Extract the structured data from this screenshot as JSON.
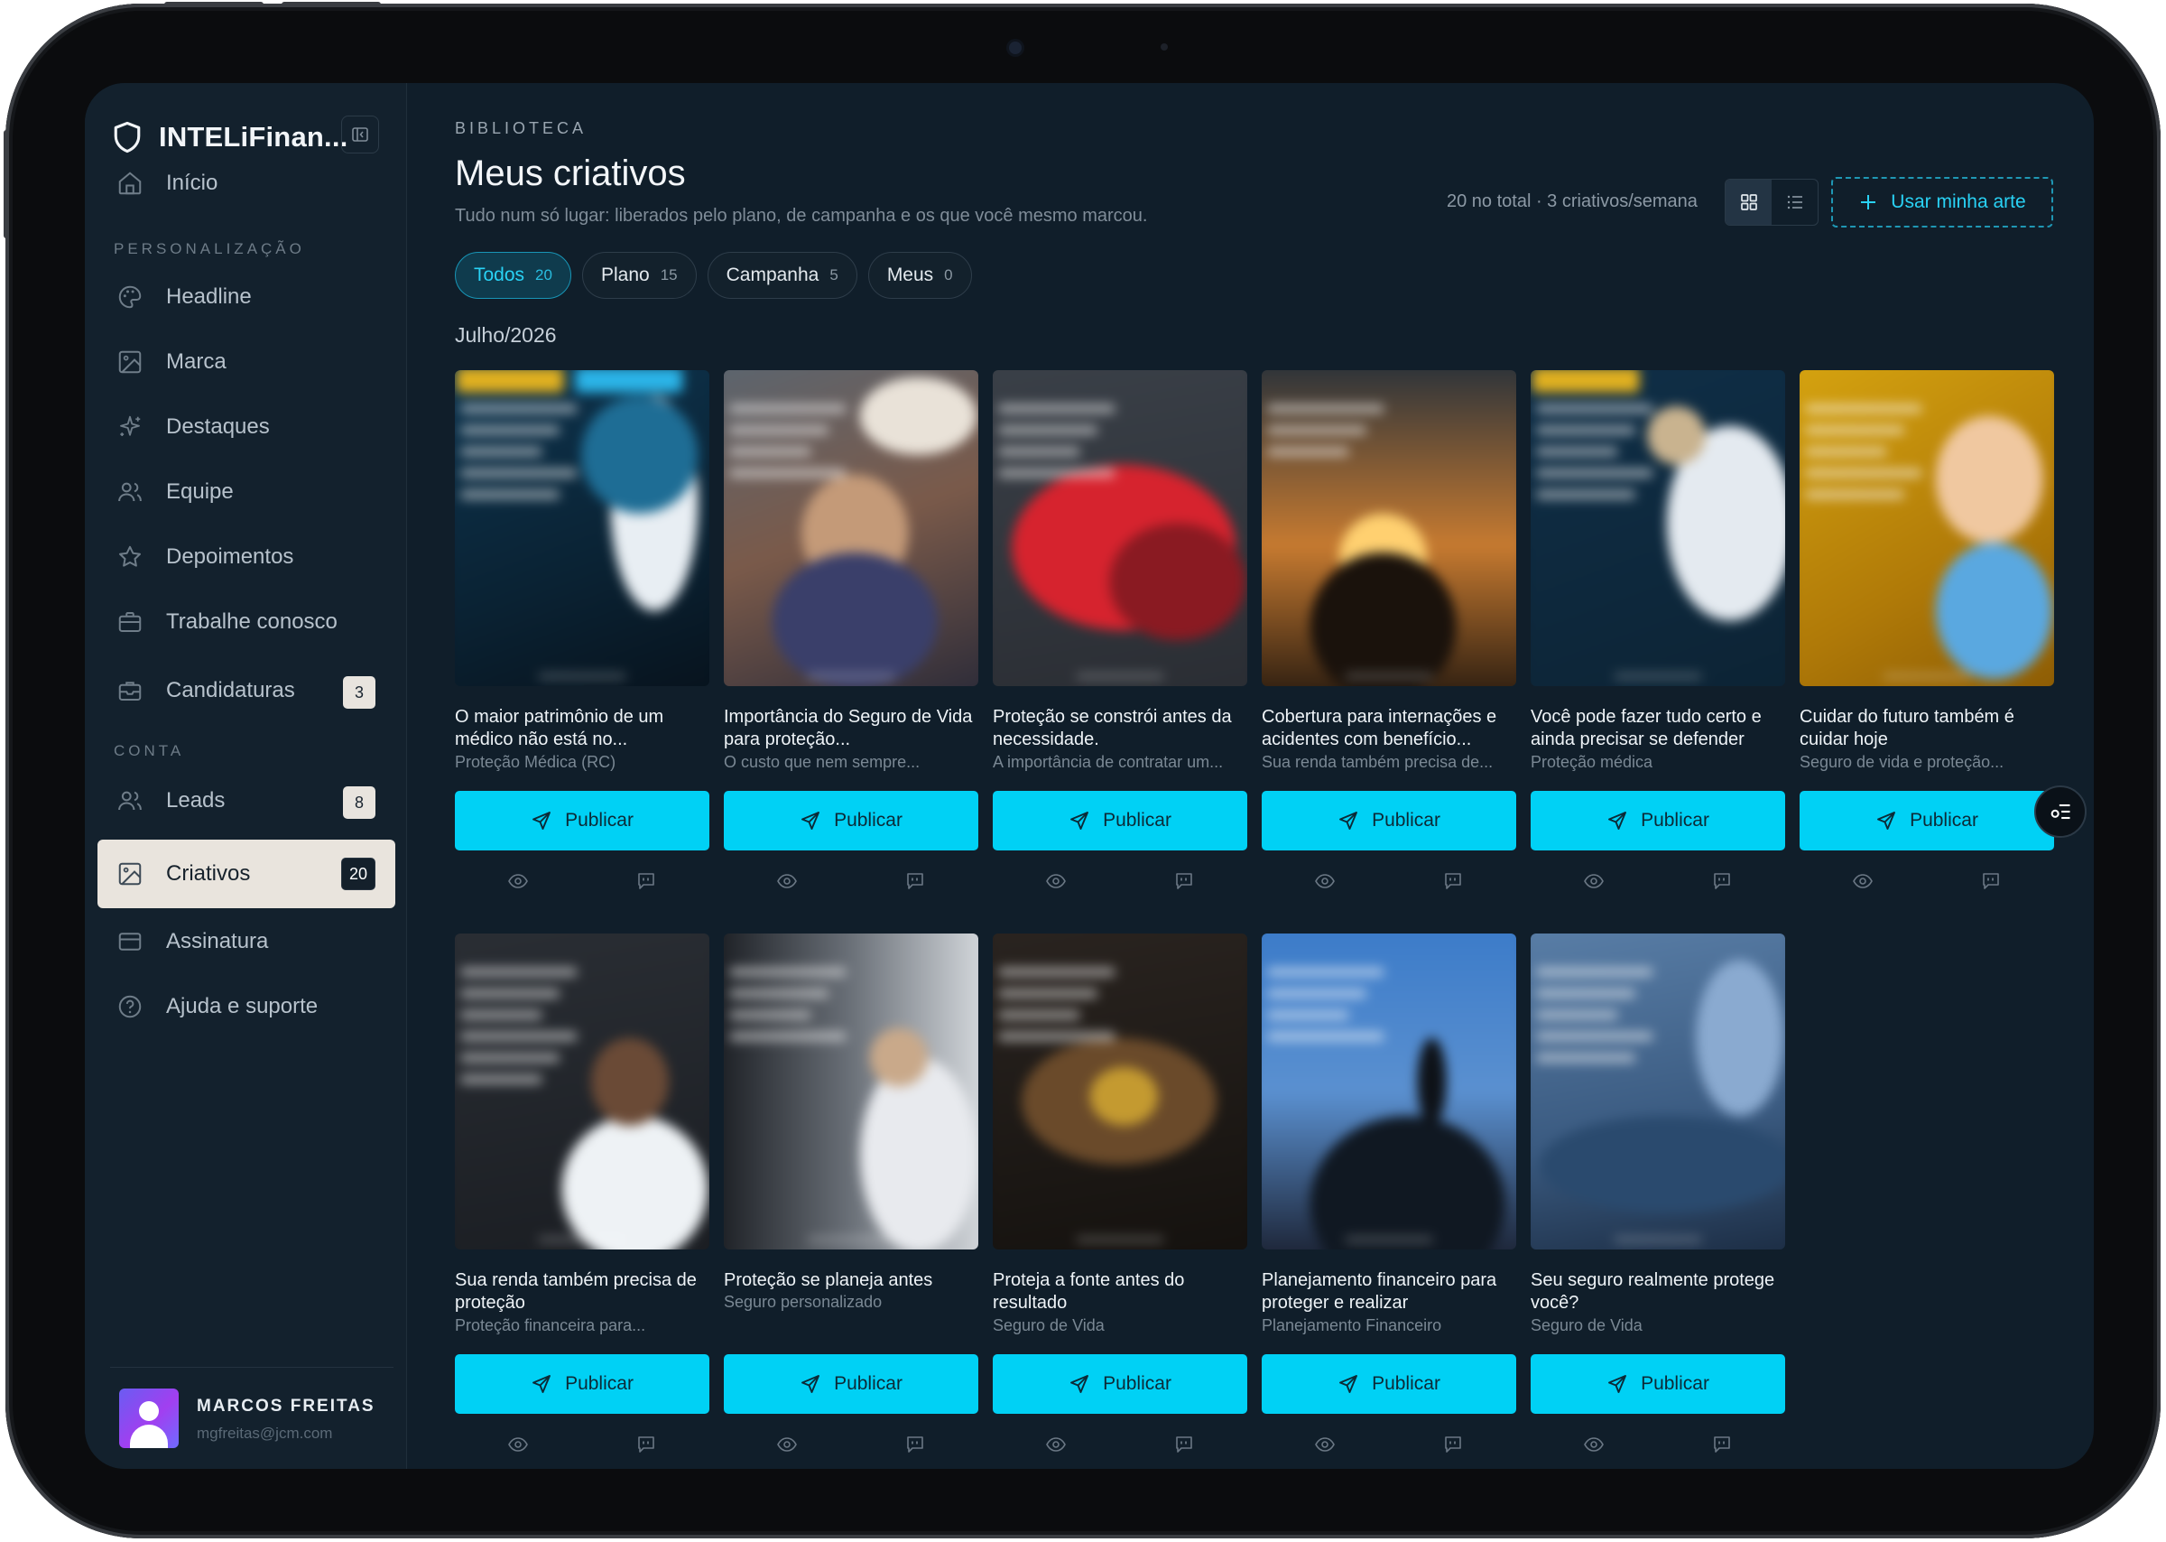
{
  "app": {
    "brand_name": "INTELiFinan..."
  },
  "sidebar": {
    "items_top": [
      {
        "label": "Início",
        "icon": "home-icon"
      }
    ],
    "section_personalizacao": "PERSONALIZAÇÃO",
    "items_personalizacao": [
      {
        "label": "Headline",
        "icon": "palette-icon"
      },
      {
        "label": "Marca",
        "icon": "image-icon"
      },
      {
        "label": "Destaques",
        "icon": "sparkles-icon"
      },
      {
        "label": "Equipe",
        "icon": "users-icon"
      },
      {
        "label": "Depoimentos",
        "icon": "star-icon"
      },
      {
        "label": "Trabalhe conosco",
        "icon": "briefcase-icon"
      },
      {
        "label": "Candidaturas",
        "icon": "inbox-icon",
        "badge": "3"
      }
    ],
    "section_conta": "CONTA",
    "items_conta": [
      {
        "label": "Leads",
        "icon": "users-icon",
        "badge": "8"
      },
      {
        "label": "Criativos",
        "icon": "image-icon",
        "badge": "20",
        "active": true
      },
      {
        "label": "Assinatura",
        "icon": "credit-card-icon"
      },
      {
        "label": "Ajuda e suporte",
        "icon": "help-circle-icon"
      }
    ],
    "user": {
      "name": "MARCOS FREITAS",
      "email": "mgfreitas@jcm.com"
    }
  },
  "header": {
    "eyebrow": "BIBLIOTECA",
    "title": "Meus criativos",
    "subtitle": "Tudo num só lugar: liberados pelo plano, de campanha e os que você mesmo marcou.",
    "total_info": "20 no total · 3 criativos/semana",
    "upload_label": "Usar minha arte"
  },
  "filters": [
    {
      "label": "Todos",
      "count": "20",
      "active": true
    },
    {
      "label": "Plano",
      "count": "15"
    },
    {
      "label": "Campanha",
      "count": "5"
    },
    {
      "label": "Meus",
      "count": "0"
    }
  ],
  "month": "Julho/2026",
  "publish_label": "Publicar",
  "cards": [
    {
      "title": "O maior patrimônio de um médico não está no...",
      "subtitle": "Proteção Médica (RC)"
    },
    {
      "title": "Importância do Seguro de Vida para proteção...",
      "subtitle": "O custo que nem sempre..."
    },
    {
      "title": "Proteção se constrói antes da necessidade.",
      "subtitle": "A importância de contratar um..."
    },
    {
      "title": "Cobertura para internações e acidentes com benefício...",
      "subtitle": "Sua renda também precisa de..."
    },
    {
      "title": "Você pode fazer tudo certo e ainda precisar se defender",
      "subtitle": "Proteção médica"
    },
    {
      "title": "Cuidar do futuro também é cuidar hoje",
      "subtitle": "Seguro de vida e proteção..."
    },
    {
      "title": "Sua renda também precisa de proteção",
      "subtitle": "Proteção financeira para..."
    },
    {
      "title": "Proteção se planeja antes",
      "subtitle": "Seguro personalizado"
    },
    {
      "title": "Proteja a fonte antes do resultado",
      "subtitle": "Seguro de Vida"
    },
    {
      "title": "Planejamento financeiro para proteger e realizar",
      "subtitle": "Planejamento Financeiro"
    },
    {
      "title": "Seu seguro realmente protege você?",
      "subtitle": "Seguro de Vida"
    }
  ]
}
